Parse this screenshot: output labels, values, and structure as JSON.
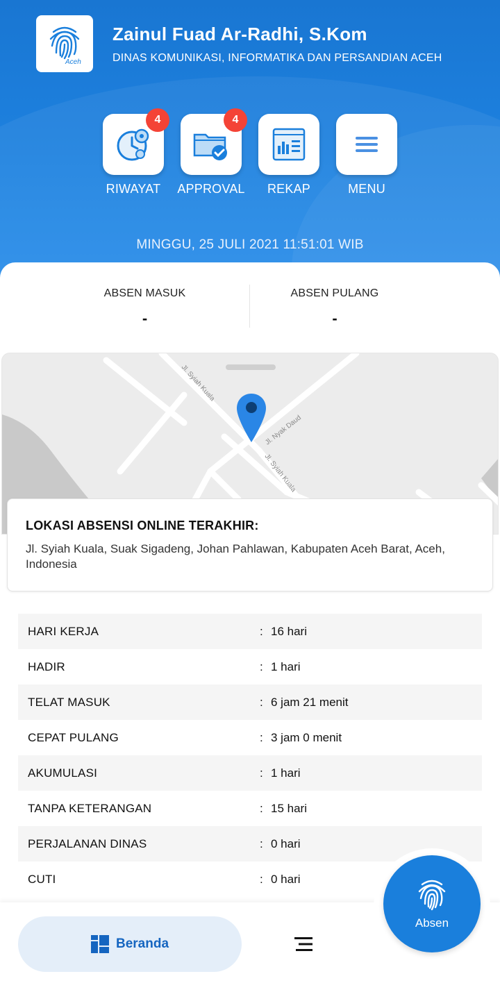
{
  "header": {
    "logo_text": "Aceh",
    "user_name": "Zainul Fuad Ar-Radhi, S.Kom",
    "org_name": "DINAS KOMUNIKASI, INFORMATIKA DAN PERSANDIAN ACEH"
  },
  "menu": {
    "items": [
      {
        "label": "RIWAYAT",
        "icon": "clock-gear-icon",
        "badge": "4"
      },
      {
        "label": "APPROVAL",
        "icon": "folder-check-icon",
        "badge": "4"
      },
      {
        "label": "REKAP",
        "icon": "report-icon",
        "badge": ""
      },
      {
        "label": "MENU",
        "icon": "hamburger-icon",
        "badge": ""
      }
    ]
  },
  "datetime": "MINGGU,  25 JULI 2021 11:51:01 WIB",
  "absen": {
    "masuk_label": "ABSEN MASUK",
    "masuk_value": "-",
    "pulang_label": "ABSEN PULANG",
    "pulang_value": "-"
  },
  "map": {
    "street_1": "Jl. Syiah Kuala",
    "street_2": "Jl. Nyak Daud",
    "street_3": "Jl. Syiah Kuala"
  },
  "location": {
    "title": "LOKASI ABSENSI ONLINE TERAKHIR:",
    "address": "Jl. Syiah Kuala, Suak Sigadeng, Johan Pahlawan, Kabupaten Aceh Barat, Aceh, Indonesia"
  },
  "stats": [
    {
      "label": "HARI KERJA",
      "value": "16 hari"
    },
    {
      "label": "HADIR",
      "value": "1 hari"
    },
    {
      "label": "TELAT MASUK",
      "value": "6 jam 21 menit"
    },
    {
      "label": "CEPAT PULANG",
      "value": "3 jam 0 menit"
    },
    {
      "label": "AKUMULASI",
      "value": "1 hari"
    },
    {
      "label": "TANPA KETERANGAN",
      "value": "15 hari"
    },
    {
      "label": "PERJALANAN DINAS",
      "value": "0 hari"
    },
    {
      "label": "CUTI",
      "value": "0 hari"
    }
  ],
  "colon": ":",
  "nav": {
    "beranda_label": "Beranda",
    "absen_label": "Absen"
  },
  "colors": {
    "primary": "#1976d2",
    "badge": "#f44336",
    "nav_active_bg": "#e4eef9"
  }
}
